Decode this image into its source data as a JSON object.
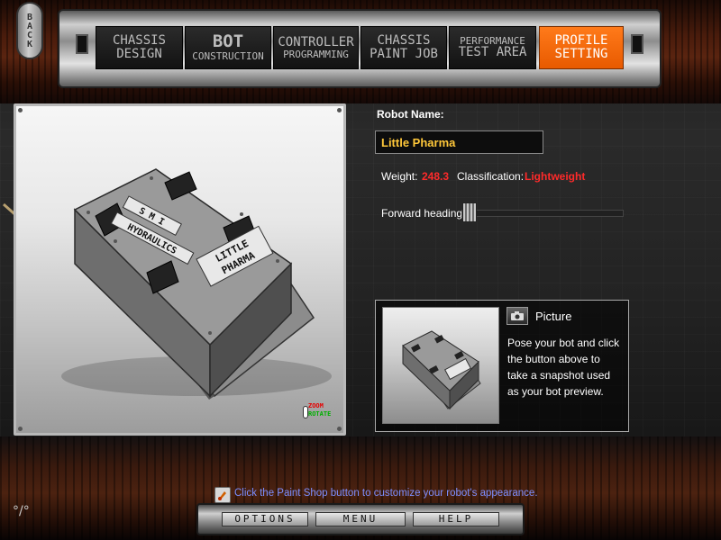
{
  "nav": {
    "back_label": "BACK",
    "tabs": [
      {
        "line1": "CHASSIS",
        "line2": "DESIGN",
        "active": false
      },
      {
        "line1": "BOT",
        "line2": "CONSTRUCTION",
        "active": false
      },
      {
        "line1": "CONTROLLER",
        "line2": "PROGRAMMING",
        "active": false
      },
      {
        "line1": "CHASSIS",
        "line2": "PAINT JOB",
        "active": false
      },
      {
        "line1": "PERFORMANCE",
        "line2": "TEST AREA",
        "active": false
      },
      {
        "line1": "PROFILE",
        "line2": "SETTING",
        "active": true
      }
    ]
  },
  "viewport": {
    "zoom_label": "ZOOM",
    "rotate_label": "ROTATE",
    "robot_decal_1": "S M I",
    "robot_decal_2": "HYDRAULICS",
    "robot_decal_3": "LITTLE",
    "robot_decal_4": "PHARMA"
  },
  "profile": {
    "robot_name_label": "Robot Name:",
    "robot_name_value": "Little Pharma",
    "weight_label": "Weight:",
    "weight_value": "248.3",
    "classification_label": "Classification:",
    "classification_value": "Lightweight",
    "heading_label": "Forward heading:",
    "heading_value": 0.0
  },
  "picture": {
    "title": "Picture",
    "description": "Pose your bot and click the button above to take a snapshot used as your bot preview."
  },
  "bottom": {
    "hint": "Click the Paint Shop button to customize your robot's appearance.",
    "options_label": "OPTIONS",
    "menu_label": "MENU",
    "help_label": "HELP"
  },
  "colors": {
    "active_tab": "#ff6a00",
    "name_text": "#ffc83a",
    "value_red": "#ff2a2a",
    "hint_text": "#7d8fff"
  }
}
